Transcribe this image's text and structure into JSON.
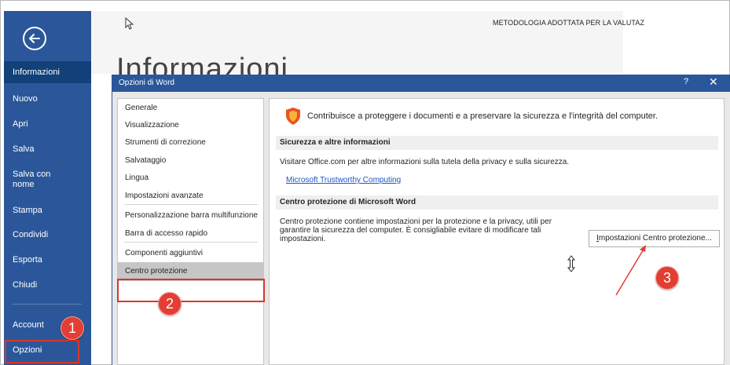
{
  "backstage": {
    "items": [
      {
        "label": "Informazioni"
      },
      {
        "label": "Nuovo"
      },
      {
        "label": "Apri"
      },
      {
        "label": "Salva"
      },
      {
        "label": "Salva con nome"
      },
      {
        "label": "Stampa"
      },
      {
        "label": "Condividi"
      },
      {
        "label": "Esporta"
      },
      {
        "label": "Chiudi"
      },
      {
        "label": "Account"
      },
      {
        "label": "Opzioni"
      }
    ]
  },
  "header": {
    "page_title": "Informazioni",
    "document_title": "METODOLOGIA ADOTTATA PER LA VALUTAZIONE"
  },
  "dialog": {
    "title": "Opzioni di Word",
    "help": "?",
    "close": "✕",
    "nav": [
      {
        "label": "Generale"
      },
      {
        "label": "Visualizzazione"
      },
      {
        "label": "Strumenti di correzione"
      },
      {
        "label": "Salvataggio"
      },
      {
        "label": "Lingua"
      },
      {
        "label": "Impostazioni avanzate"
      },
      {
        "label": "Personalizzazione barra multifunzione"
      },
      {
        "label": "Barra di accesso rapido"
      },
      {
        "label": "Componenti aggiuntivi"
      },
      {
        "label": "Centro protezione"
      }
    ],
    "content": {
      "intro": "Contribuisce a proteggere i documenti e a preservare la sicurezza e l'integrità del computer.",
      "section1_title": "Sicurezza e altre informazioni",
      "section1_text": "Visitare Office.com per altre informazioni sulla tutela della privacy e sulla sicurezza.",
      "section1_link": "Microsoft Trustworthy Computing",
      "section2_title": "Centro protezione di Microsoft Word",
      "section2_text": "Centro protezione contiene impostazioni per la protezione e la privacy, utili per garantire la sicurezza del computer. È consigliabile evitare di modificare tali impostazioni.",
      "button_label_prefix": "I",
      "button_label_rest": "mpostazioni Centro protezione..."
    }
  },
  "markers": {
    "one": "1",
    "two": "2",
    "three": "3"
  },
  "colors": {
    "backstage_blue": "#2b579a",
    "marker_red": "#e23e33",
    "link_blue": "#1c56c4"
  }
}
